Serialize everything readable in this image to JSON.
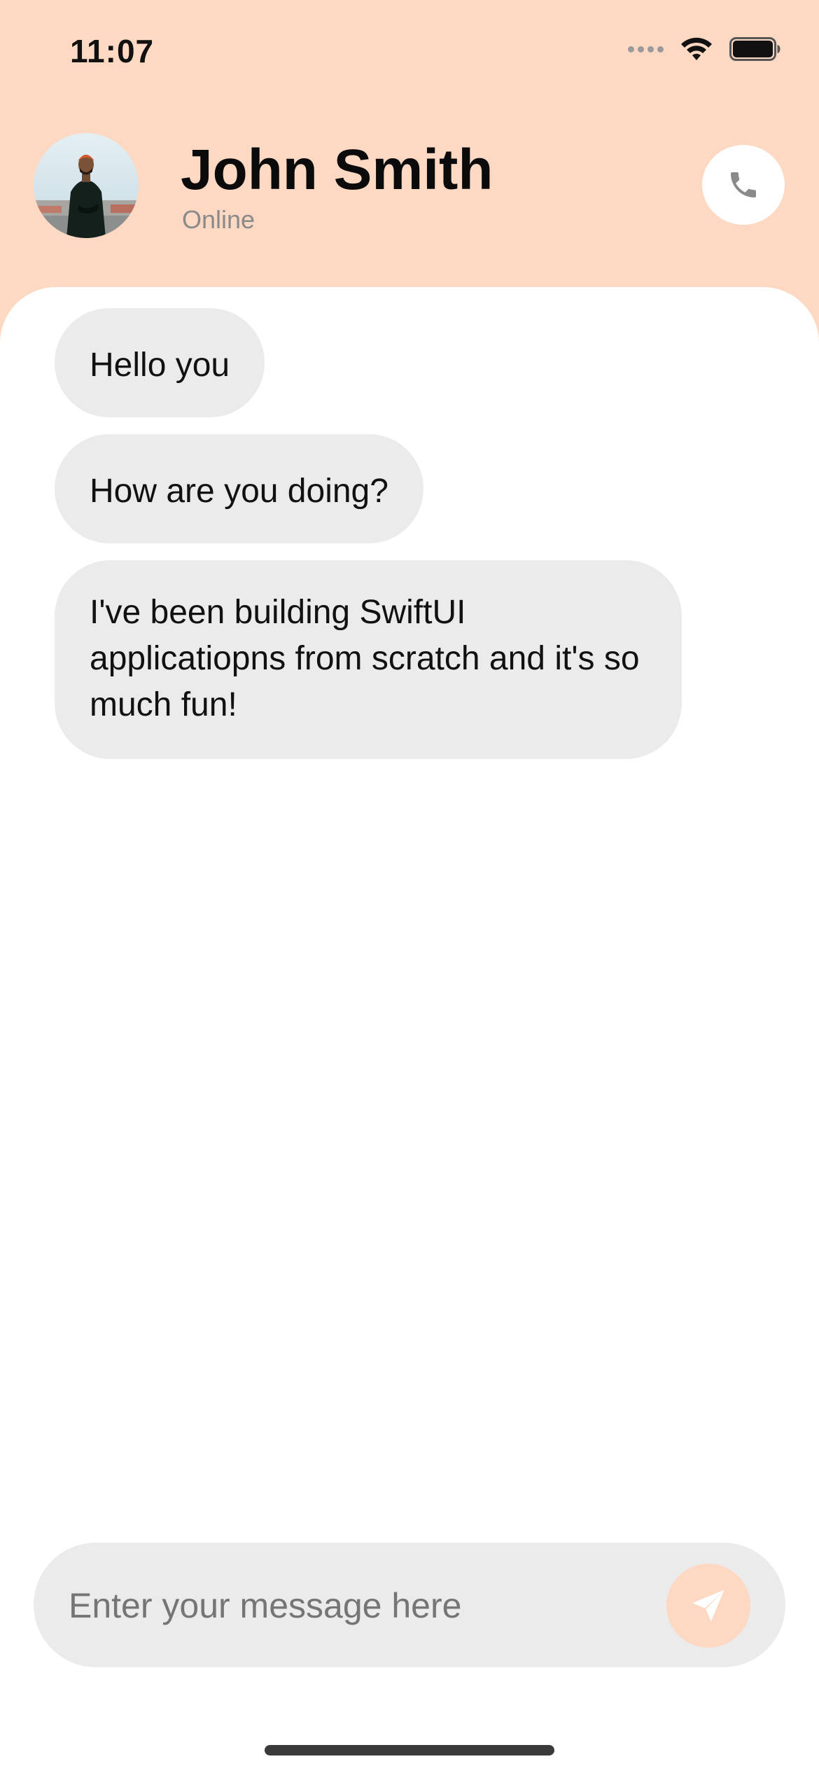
{
  "status_bar": {
    "time": "11:07"
  },
  "header": {
    "name": "John Smith",
    "status": "Online",
    "avatar_icon": "avatar-photo",
    "call_icon": "phone-icon"
  },
  "messages": [
    {
      "text": "Hello you"
    },
    {
      "text": "How are you doing?"
    },
    {
      "text": "I've been building SwiftUI applicatiopns from scratch and it's so much fun!"
    }
  ],
  "composer": {
    "placeholder": "Enter your message here",
    "send_icon": "send-icon"
  },
  "colors": {
    "accent": "#FDD8C3",
    "bubble": "#EBEBEB",
    "background": "#FFFFFF"
  }
}
